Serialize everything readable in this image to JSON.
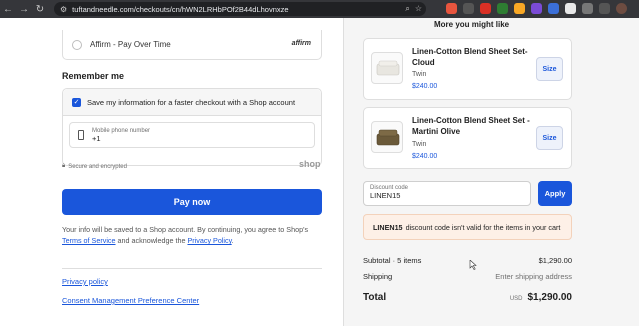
{
  "browser": {
    "url": "tuftandneedle.com/checkouts/cn/hWN2LRHbPOf2B44dLhovnxze",
    "back_icon": "←",
    "forward_icon": "→",
    "reload_icon": "↻",
    "tune_icon": "⚙"
  },
  "payment": {
    "affirm_label": "Affirm - Pay Over Time",
    "affirm_logo": "affirm"
  },
  "remember": {
    "title": "Remember me",
    "checkbox_label": "Save my information for a faster checkout with a Shop account",
    "phone_label": "Mobile phone number",
    "phone_value": "+1",
    "secure_text": "Secure and encrypted",
    "shop_logo": "shop"
  },
  "pay_button": "Pay now",
  "consent": {
    "text_before": "Your info will be saved to a Shop account. By continuing, you agree to Shop's ",
    "terms": "Terms of Service",
    "text_middle": " and acknowledge the ",
    "privacy": "Privacy Policy",
    "text_after": "."
  },
  "footer": {
    "privacy_policy": "Privacy policy",
    "consent_center": "Consent Management Preference Center"
  },
  "recommendations": {
    "title": "More you might like",
    "products": [
      {
        "name": "Linen-Cotton Blend Sheet Set- Cloud",
        "variant": "Twin",
        "price": "$240.00",
        "size_label": "Size"
      },
      {
        "name": "Linen-Cotton Blend Sheet Set - Martini Olive",
        "variant": "Twin",
        "price": "$240.00",
        "size_label": "Size"
      }
    ]
  },
  "discount": {
    "label": "Discount code",
    "value": "LINEN15",
    "apply": "Apply",
    "error_code": "LINEN15",
    "error_text": "discount code isn't valid for the items in your cart"
  },
  "summary": {
    "subtotal_label": "Subtotal · 5 items",
    "subtotal_value": "$1,290.00",
    "shipping_label": "Shipping",
    "shipping_value": "Enter shipping address",
    "total_label": "Total",
    "currency": "USD",
    "total_value": "$1,290.00"
  },
  "colors": {
    "accent": "#1a56db",
    "error_bg": "#fdf0e7"
  }
}
